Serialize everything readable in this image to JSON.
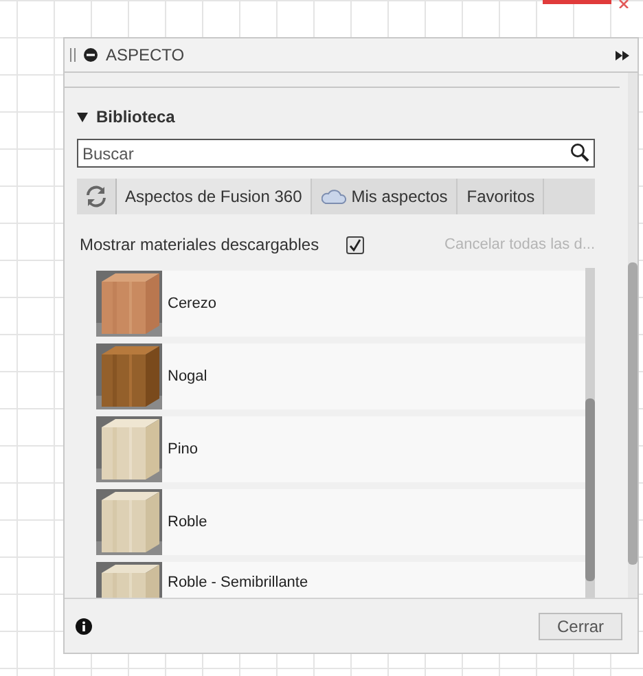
{
  "panel": {
    "title": "ASPECTO"
  },
  "section": {
    "title": "Biblioteca",
    "expanded": true
  },
  "search": {
    "placeholder": "Buscar"
  },
  "tabs": [
    {
      "label": "Aspectos de Fusion 360",
      "selected": true
    },
    {
      "label": "Mis aspectos",
      "selected": false
    },
    {
      "label": "Favoritos",
      "selected": false
    }
  ],
  "download_toggle": {
    "label": "Mostrar materiales descargables",
    "checked": true
  },
  "cancel_link": {
    "label": "Cancelar todas las d...",
    "disabled": true
  },
  "materials": [
    {
      "name": "Cerezo"
    },
    {
      "name": "Nogal"
    },
    {
      "name": "Pino"
    },
    {
      "name": "Roble"
    },
    {
      "name": "Roble - Semibrillante"
    }
  ],
  "footer": {
    "button": "Cerrar"
  }
}
